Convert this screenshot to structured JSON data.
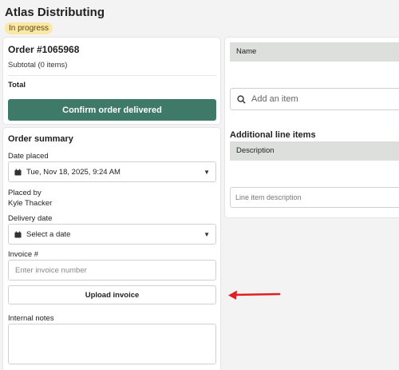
{
  "header": {
    "title": "Atlas Distributing",
    "status": "In progress"
  },
  "order": {
    "id": "Order #1065968",
    "subtotal": "Subtotal (0 items)",
    "total_label": "Total",
    "confirm_label": "Confirm order delivered"
  },
  "summary": {
    "title": "Order summary",
    "date_placed_label": "Date placed",
    "date_placed_value": "Tue, Nov 18, 2025, 9:24 AM",
    "placed_by_label": "Placed by",
    "placed_by_value": "Kyle Thacker",
    "delivery_label": "Delivery date",
    "delivery_value": "Select a date",
    "invoice_label": "Invoice #",
    "invoice_placeholder": "Enter invoice number",
    "upload_label": "Upload invoice",
    "notes_label": "Internal notes"
  },
  "items": {
    "name_header": "Name",
    "add_placeholder": "Add an item",
    "additional_title": "Additional line items",
    "description_header": "Description",
    "line_placeholder": "Line item description"
  },
  "colors": {
    "accent": "#3f7a69",
    "badge": "#fbe7a6",
    "arrow": "#e02020"
  },
  "icons": {
    "calendar": "calendar-icon",
    "caret": "caret-down-icon",
    "search": "search-icon",
    "arrow": "left-arrow-icon"
  }
}
